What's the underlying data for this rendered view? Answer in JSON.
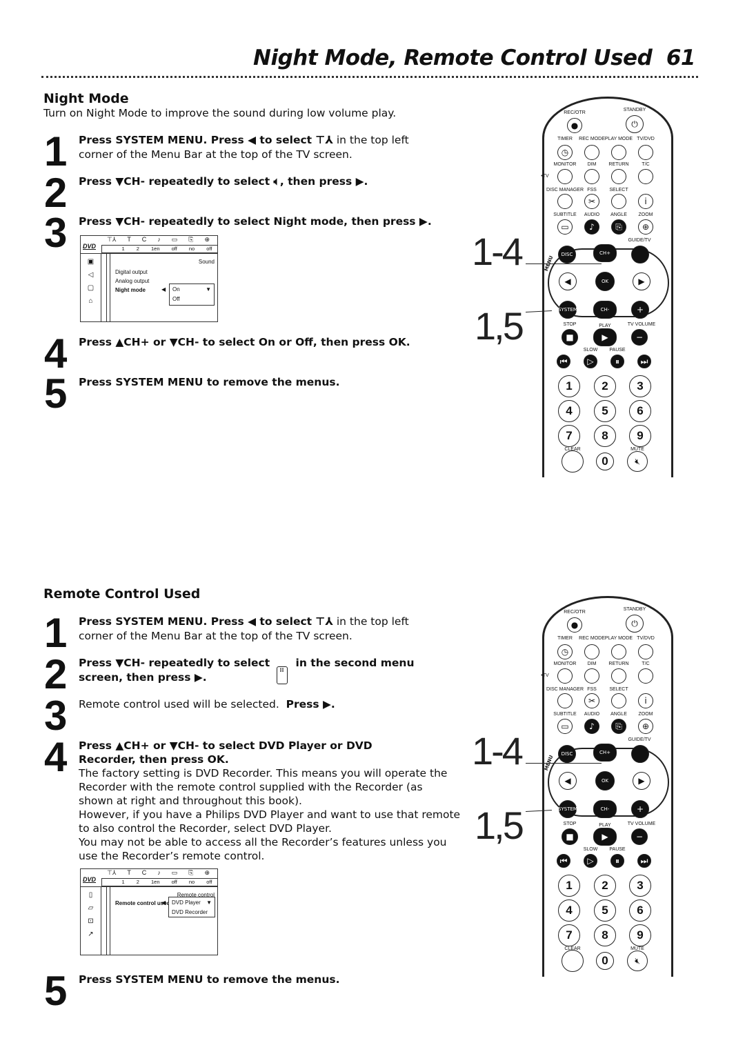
{
  "page": {
    "title": "Night Mode, Remote Control Used",
    "number": "61"
  },
  "night": {
    "heading": "Night Mode",
    "intro": "Turn on Night Mode to improve the sound during low volume play.",
    "steps": [
      {
        "n": "1",
        "l1a": "Press SYSTEM MENU.  Press ◀ to select",
        "l1b": " in the top left",
        "l2": "corner of the Menu Bar at the top of the TV screen."
      },
      {
        "n": "2",
        "l1a": "Press ▼CH- repeatedly to select",
        "l1b": ", then press ▶."
      },
      {
        "n": "3",
        "l1": "Press ▼CH- repeatedly to select Night mode, then press ▶."
      },
      {
        "n": "4",
        "l1": "Press ▲CH+ or ▼CH- to select On or Off, then press OK."
      },
      {
        "n": "5",
        "l1": "Press SYSTEM MENU to remove the menus."
      }
    ],
    "menu": {
      "logo": "DVD",
      "top_values": [
        "1",
        "2",
        "1en",
        "off",
        "no",
        "off"
      ],
      "section": "Sound",
      "items": [
        "Digital output",
        "Analog output",
        "Night mode"
      ],
      "options": [
        "On",
        "Off"
      ]
    }
  },
  "remote_section": {
    "heading": "Remote Control Used",
    "steps": [
      {
        "n": "1",
        "l1a": "Press SYSTEM MENU.  Press ◀ to select",
        "l1b": " in the top left",
        "l2": "corner of the Menu Bar at the top of the TV screen."
      },
      {
        "n": "2",
        "l1a": "Press ▼CH- repeatedly to select",
        "l1b": "in the second menu",
        "l2": "screen, then press ▶."
      },
      {
        "n": "3",
        "l1a": "Remote control used will be selected.",
        "l1b": "Press ▶."
      },
      {
        "n": "4",
        "l1": "Press ▲CH+ or ▼CH- to select DVD Player or DVD",
        "l2": "Recorder, then press OK.",
        "body": [
          "The factory setting is DVD Recorder. This means you will operate the",
          "Recorder with the remote control supplied with the Recorder (as",
          "shown at right and throughout this book).",
          "However, if you have a Philips DVD Player and want to use that remote",
          "to also control the Recorder, select DVD Player.",
          "You may not be able to access all the Recorder’s features unless you",
          "use the Recorder’s remote control."
        ]
      },
      {
        "n": "5",
        "l1": "Press SYSTEM MENU to remove the menus."
      }
    ],
    "menu": {
      "logo": "DVD",
      "top_values": [
        "1",
        "2",
        "1en",
        "off",
        "no",
        "off"
      ],
      "section": "Remote control",
      "item": "Remote control used",
      "options": [
        "DVD Player",
        "DVD Recorder"
      ]
    }
  },
  "callouts": {
    "a": "1-4",
    "b": "1,5"
  },
  "remote": {
    "labels": {
      "rec": "REC/OTR",
      "standby": "STANDBY",
      "timer": "TIMER",
      "rec_mode": "REC MODE",
      "play_mode": "PLAY MODE",
      "tv_dvd": "TV/DVD",
      "monitor": "MONITOR",
      "dim": "DIM",
      "return": "RETURN",
      "tc": "T/C",
      "tv": "•TV",
      "disc_manager": "DISC MANAGER",
      "fss": "FSS",
      "select": "SELECT",
      "subtitle": "SUBTITLE",
      "audio": "AUDIO",
      "angle": "ANGLE",
      "zoom": "ZOOM",
      "guide": "GUIDE/TV",
      "menu": "MENU",
      "disc": "DISC",
      "chplus": "CH+",
      "ok": "OK",
      "system": "SYSTEM",
      "chminus": "CH-",
      "stop": "STOP",
      "play": "PLAY",
      "tv_volume": "TV VOLUME",
      "slow": "SLOW",
      "pause": "PAUSE",
      "clear": "CLEAR",
      "mute": "MUTE"
    },
    "digits": [
      "1",
      "2",
      "3",
      "4",
      "5",
      "6",
      "7",
      "8",
      "9",
      "0"
    ]
  }
}
